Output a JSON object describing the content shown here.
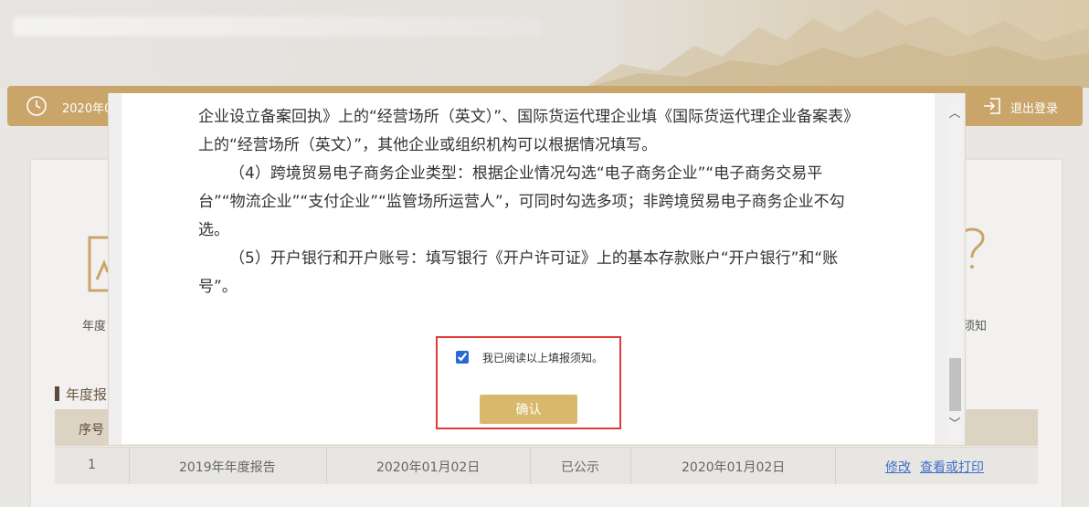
{
  "header": {
    "date_text": "2020年0",
    "logout_label": "退出登录"
  },
  "cards": {
    "left_label": "年度",
    "right_label": "须知"
  },
  "section": {
    "title": "年度报"
  },
  "table": {
    "header_seq": "序号",
    "rows": [
      {
        "seq": "1",
        "report": "2019年年度报告",
        "submit_date": "2020年01月02日",
        "status": "已公示",
        "publish_date": "2020年01月02日",
        "action_edit": "修改",
        "action_view": "查看或打印"
      }
    ]
  },
  "dialog": {
    "paragraphs": [
      "企业设立备案回执》上的“经营场所（英文）”、国际货运代理企业填《国际货运代理企业备案表》上的“经营场所（英文）”，其他企业或组织机构可以根据情况填写。",
      "（4）跨境贸易电子商务企业类型：根据企业情况勾选“电子商务企业”“电子商务交易平台”“物流企业”“支付企业”“监管场所运营人”，可同时勾选多项；非跨境贸易电子商务企业不勾选。",
      "（5）开户银行和开户账号：填写银行《开户许可证》上的基本存款账户“开户银行”和“账号”。"
    ],
    "agree_label": "我已阅读以上填报须知。",
    "agree_checked": true,
    "confirm_label": "确认"
  },
  "colors": {
    "navbar": "#c9a56a",
    "confirm_button": "#d8b96c",
    "highlight_border": "#e0393a",
    "link": "#3f6fc7"
  }
}
